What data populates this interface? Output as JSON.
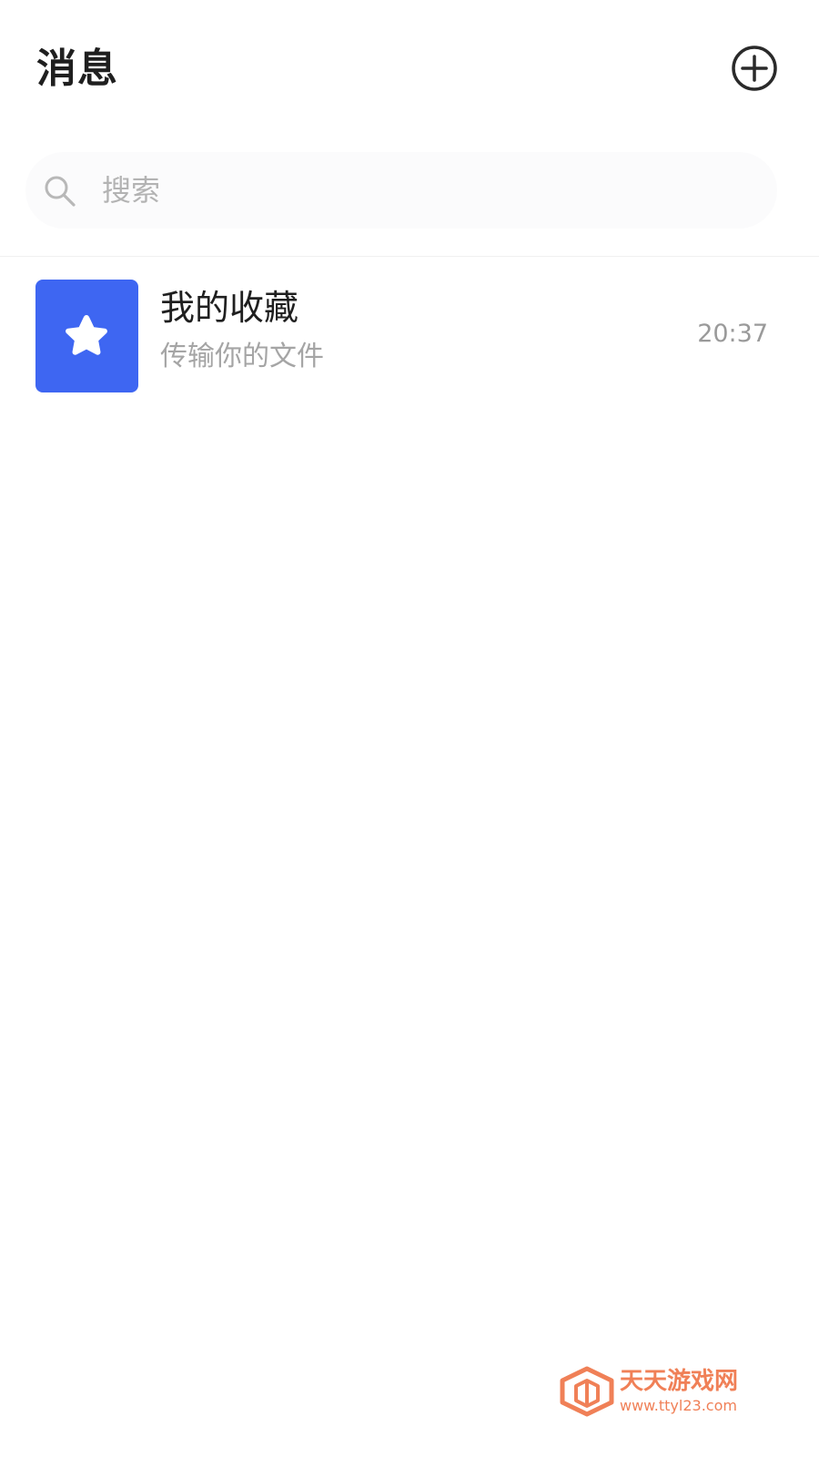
{
  "header": {
    "title": "消息",
    "add_icon": "plus-circle-icon"
  },
  "search": {
    "placeholder": "搜索",
    "value": "",
    "icon": "search-icon"
  },
  "chats": [
    {
      "title": "我的收藏",
      "subtitle": "传输你的文件",
      "time": "20:37",
      "avatar_icon": "star-icon",
      "avatar_color": "#3e66f2"
    }
  ],
  "watermark": {
    "name": "天天游戏网",
    "url": "www.ttyl23.com",
    "color": "#f08057"
  }
}
